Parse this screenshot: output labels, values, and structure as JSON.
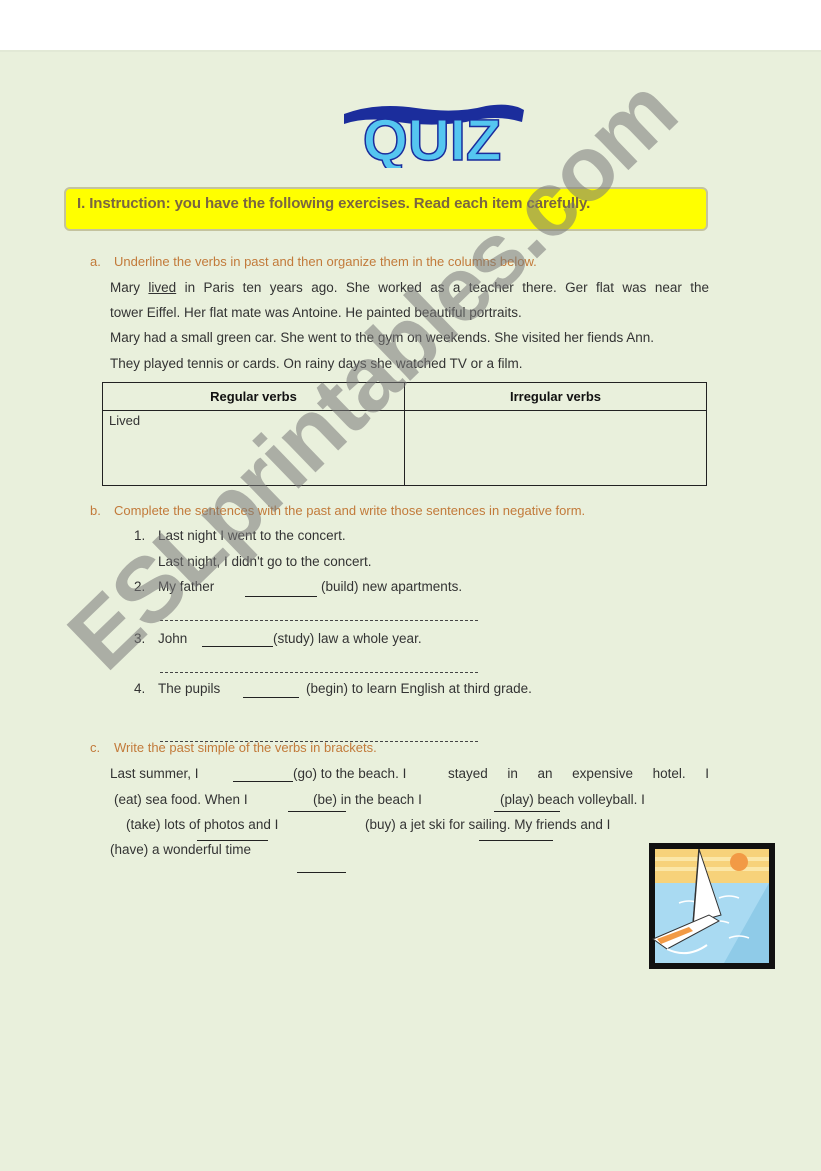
{
  "title": "QUIZ",
  "instruction": "I.  Instruction: you have the following exercises. Read each item carefully.",
  "section_a": {
    "label": "a.",
    "heading": "Underline the verbs in past and then organize them in the columns below.",
    "paragraph": {
      "line1_pre": "Mary ",
      "line1_underlined": "lived",
      "line1_post": " in Paris ten years ago. She worked as a teacher there. Ger flat was near the",
      "line2": "tower Eiffel. Her flat mate was Antoine. He painted beautiful portraits.",
      "line3": "Mary had a small green car. She went to the gym on weekends. She visited her fiends Ann.",
      "line4": "They played tennis or cards. On rainy days she watched TV or a film."
    },
    "table": {
      "headers": [
        "Regular verbs",
        "Irregular verbs"
      ],
      "rows": [
        [
          "Lived",
          ""
        ]
      ]
    }
  },
  "section_b": {
    "label": "b.",
    "heading": "Complete the sentences with the past and write those sentences in negative form.",
    "items": [
      {
        "num": "1.",
        "text": "Last night I went to the concert.",
        "answer": "Last night, I didn't go to the concert."
      },
      {
        "num": "2.",
        "pre": "My father",
        "post": "(build) new apartments."
      },
      {
        "num": "3.",
        "pre": "John",
        "post": "(study) law a whole year."
      },
      {
        "num": "4.",
        "pre": "The pupils",
        "post": "(begin) to learn English at third grade."
      }
    ]
  },
  "section_c": {
    "label": "c.",
    "heading": "Write the past simple of the verbs in brackets.",
    "line1_a": "Last summer, I",
    "line1_b": "(go) to the beach. I",
    "line1_c": "stayed in an expensive hotel. I",
    "line2_a": "(eat) sea food. When I",
    "line2_b": "(be) in the beach I",
    "line2_c": "(play) beach volleyball. I",
    "line3_a": "(take) lots of photos and I",
    "line3_b": "(buy) a jet ski for sailing. My friends and I",
    "line4": "(have) a wonderful time"
  },
  "watermark": "ESLprintables.com",
  "clipart": {
    "icon": "sailboat-icon",
    "colors": {
      "sky": "#f7d27a",
      "sun": "#f29a45",
      "sea": "#a9daf2",
      "frame": "#111111"
    }
  },
  "colors": {
    "page_bg": "#e9f0dc",
    "instruction_bg": "#ffff00",
    "heading": "#c27a3a",
    "title_light": "#55c6f0",
    "title_dark": "#1a2a9a"
  }
}
